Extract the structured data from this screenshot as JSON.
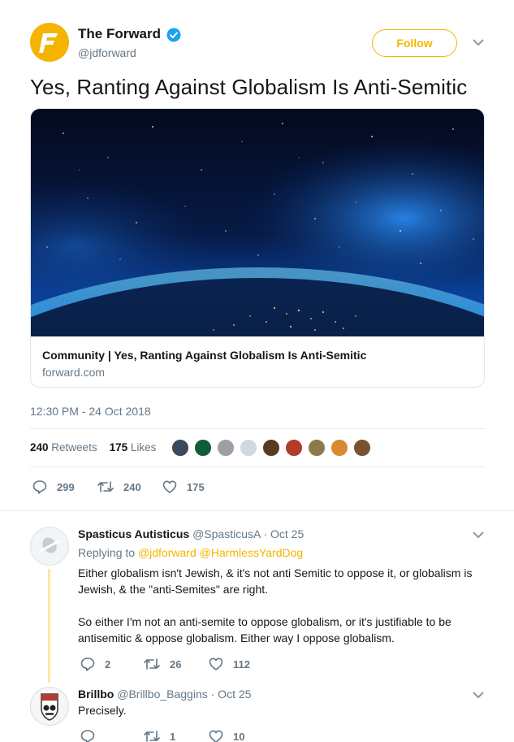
{
  "tweet": {
    "author_name": "The Forward",
    "author_handle": "@jdforward",
    "follow_label": "Follow",
    "text": "Yes, Ranting Against Globalism Is Anti-Semitic",
    "card": {
      "title": "Community | Yes, Ranting Against Globalism Is Anti-Semitic",
      "domain": "forward.com"
    },
    "timestamp": "12:30 PM - 24 Oct 2018",
    "retweets_count": "240",
    "retweets_label": "Retweets",
    "likes_count": "175",
    "likes_label": "Likes",
    "actions": {
      "replies": "299",
      "retweets": "240",
      "likes": "175"
    },
    "brand_color": "#f4b400"
  },
  "replies": [
    {
      "name": "Spasticus Autisticus",
      "handle": "@SpasticusA",
      "date": "· Oct 25",
      "replying_prefix": "Replying to",
      "replying_to": "@jdforward @HarmlessYardDog",
      "lines": [
        "Either globalism isn't Jewish, & it's not anti Semitic to oppose it, or globalism is",
        "Jewish, & the \"anti-Semites\" are right.",
        "So either I'm not an anti-semite to oppose globalism, or it's justifiable to be",
        "antisemitic & oppose globalism. Either way I oppose globalism."
      ],
      "actions": {
        "replies": "2",
        "retweets": "26",
        "likes": "112"
      }
    },
    {
      "name": "Brillbo",
      "handle": "@Brillbo_Baggins",
      "date": "· Oct 25",
      "text": "Precisely.",
      "actions": {
        "replies": "",
        "retweets": "1",
        "likes": "10"
      }
    }
  ]
}
